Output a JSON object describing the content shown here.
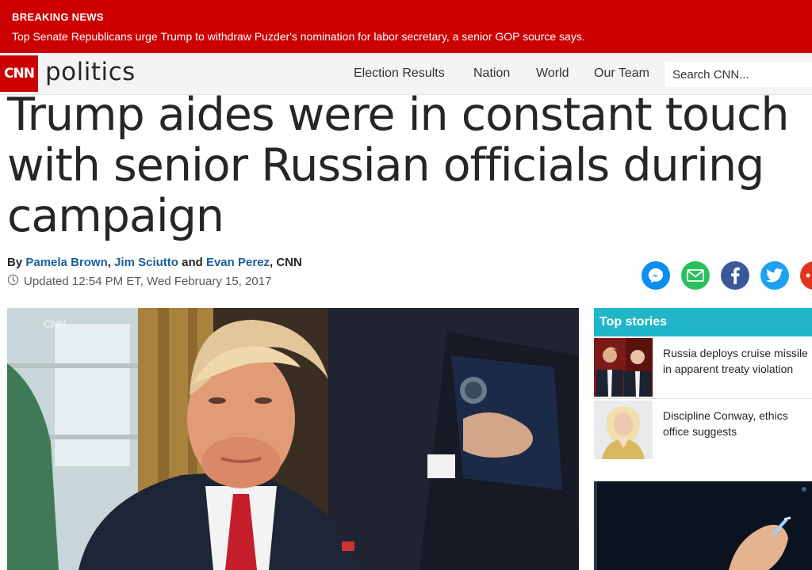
{
  "breaking": {
    "label": "BREAKING NEWS",
    "text": "Top Senate Republicans urge Trump to withdraw Puzder's nomination for labor secretary, a senior GOP source says."
  },
  "nav": {
    "logo": "CNN",
    "section": "politics",
    "links": [
      "Election Results",
      "Nation",
      "World",
      "Our Team"
    ],
    "search_placeholder": "Search CNN..."
  },
  "article": {
    "headline": "Trump aides were in constant touch with senior Russian officials during campaign",
    "byline": {
      "prefix": "By",
      "authors": [
        "Pamela Brown",
        "Jim Sciutto",
        "Evan Perez"
      ],
      "separator": ",",
      "and": "and",
      "outlet": ", CNN"
    },
    "updated": "Updated 12:54 PM ET, Wed February 15, 2017"
  },
  "share": {
    "icons": [
      "messenger-icon",
      "email-icon",
      "facebook-icon",
      "twitter-icon",
      "more-icon"
    ],
    "colors": {
      "messenger": "#0a8ef0",
      "email": "#29c15c",
      "facebook": "#3b5998",
      "twitter": "#1da1f2",
      "more": "#e1341e"
    }
  },
  "hero": {
    "watermark": "CNN"
  },
  "sidebar": {
    "heading": "Top stories",
    "stories": [
      {
        "title_line1": "Russia deploys cruise missile",
        "title_line2": "in apparent treaty violation"
      },
      {
        "title_line1": "Discipline Conway, ethics",
        "title_line2": "office suggests"
      }
    ]
  },
  "colors": {
    "brand_red": "#cc0000",
    "accent_teal": "#21b6c7",
    "link_blue": "#1a5e9e"
  }
}
